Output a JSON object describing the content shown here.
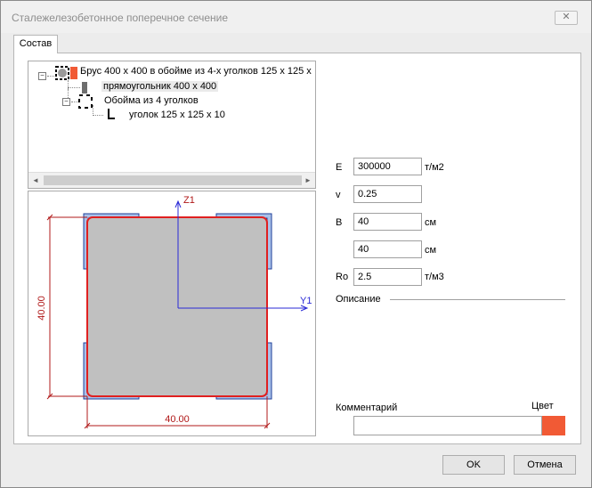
{
  "window": {
    "title": "Сталежелезобетонное поперечное сечение",
    "close_glyph": "✕"
  },
  "tabs": [
    {
      "label": "Состав"
    }
  ],
  "tree": {
    "items": [
      {
        "label": "Брус 400 x 400 в обойме из 4-х уголков 125 x 125 x"
      },
      {
        "label": "прямоугольник 400 x 400"
      },
      {
        "label": "Обойма из 4 уголков"
      },
      {
        "label": "уголок 125 x 125 x 10"
      }
    ],
    "scroll_left": "◄",
    "scroll_right": "►",
    "expanded_glyph": "−"
  },
  "drawing": {
    "axis_z": "Z1",
    "axis_y": "Y1",
    "dim_vertical": "40.00",
    "dim_horizontal": "40.00"
  },
  "fields": {
    "E": {
      "label": "E",
      "value": "300000",
      "unit": "т/м2"
    },
    "v": {
      "label": "v",
      "value": "0.25"
    },
    "B": {
      "label": "B",
      "value": "40",
      "unit": "см"
    },
    "H": {
      "value": "40",
      "unit": "см"
    },
    "Ro": {
      "label": "Ro",
      "value": "2.5",
      "unit": "т/м3"
    }
  },
  "description_label": "Описание",
  "comment": {
    "label": "Комментарий",
    "value": ""
  },
  "color": {
    "label": "Цвет",
    "value": "#f15a35"
  },
  "colors": {
    "outline": "#e02020",
    "fill": "#c0c0c0",
    "angle_fill": "#a9c1e8",
    "axis": "#2a2ad6",
    "dim": "#b01818"
  },
  "buttons": {
    "ok": "OK",
    "cancel": "Отмена"
  }
}
